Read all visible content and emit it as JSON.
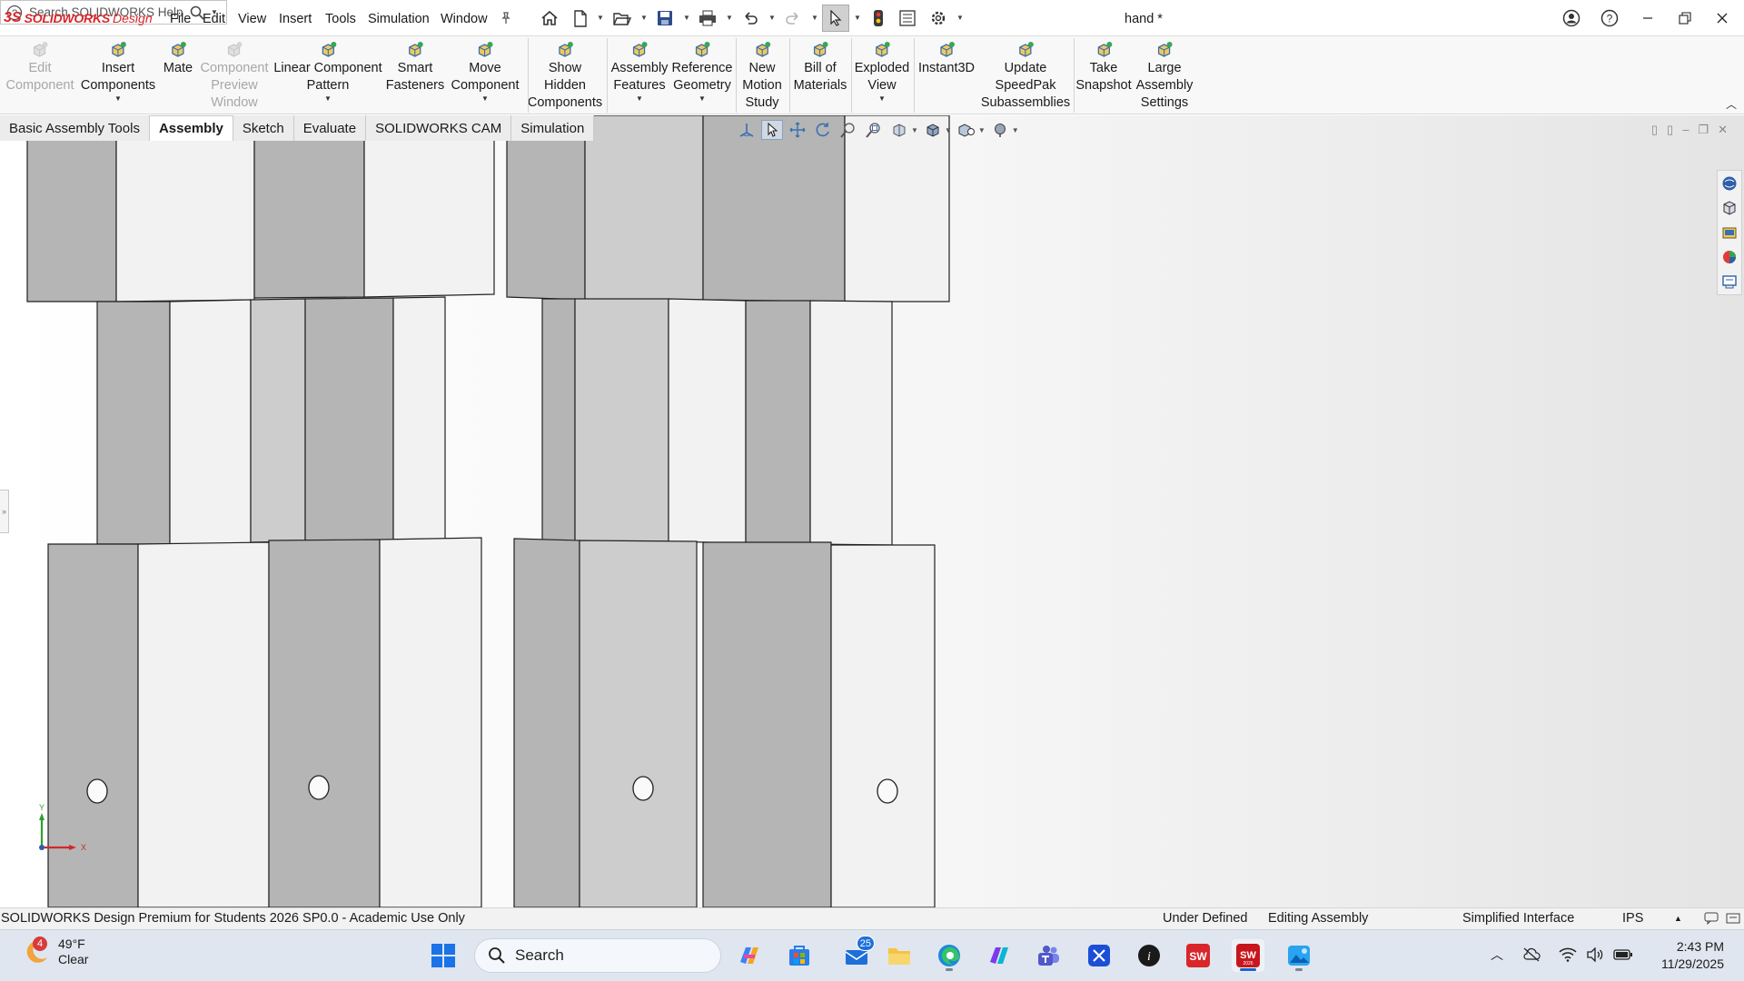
{
  "app": {
    "logo_prefix": "3S",
    "brand": "SOLIDWORKS",
    "brand_suffix": "Design",
    "document_title": "hand *"
  },
  "menu": [
    "File",
    "Edit",
    "View",
    "Insert",
    "Tools",
    "Simulation",
    "Window"
  ],
  "help_search": {
    "placeholder": "Search SOLIDWORKS Help"
  },
  "command_manager": [
    {
      "id": "edit-component",
      "lines": [
        "Edit",
        "Component"
      ],
      "disabled": true,
      "dropdown": false,
      "icon": "edit-component-icon"
    },
    {
      "id": "insert-components",
      "lines": [
        "Insert",
        "Components"
      ],
      "disabled": false,
      "dropdown": true,
      "icon": "insert-components-icon"
    },
    {
      "id": "mate",
      "lines": [
        "Mate"
      ],
      "disabled": false,
      "dropdown": false,
      "icon": "mate-icon"
    },
    {
      "id": "component-preview-window",
      "lines": [
        "Component",
        "Preview",
        "Window"
      ],
      "disabled": true,
      "dropdown": false,
      "icon": "preview-window-icon"
    },
    {
      "id": "linear-component-pattern",
      "lines": [
        "Linear Component",
        "Pattern"
      ],
      "disabled": false,
      "dropdown": true,
      "icon": "linear-pattern-icon"
    },
    {
      "id": "smart-fasteners",
      "lines": [
        "Smart",
        "Fasteners"
      ],
      "disabled": false,
      "dropdown": false,
      "icon": "smart-fasteners-icon"
    },
    {
      "id": "move-component",
      "lines": [
        "Move",
        "Component"
      ],
      "disabled": false,
      "dropdown": true,
      "icon": "move-component-icon"
    },
    {
      "id": "show-hidden-components",
      "lines": [
        "Show",
        "Hidden",
        "Components"
      ],
      "disabled": false,
      "dropdown": false,
      "icon": "show-hidden-icon"
    },
    {
      "id": "assembly-features",
      "lines": [
        "Assembly",
        "Features"
      ],
      "disabled": false,
      "dropdown": true,
      "icon": "assembly-features-icon"
    },
    {
      "id": "reference-geometry",
      "lines": [
        "Reference",
        "Geometry"
      ],
      "disabled": false,
      "dropdown": true,
      "icon": "reference-geometry-icon"
    },
    {
      "id": "new-motion-study",
      "lines": [
        "New",
        "Motion",
        "Study"
      ],
      "disabled": false,
      "dropdown": false,
      "icon": "motion-study-icon"
    },
    {
      "id": "bill-of-materials",
      "lines": [
        "Bill of",
        "Materials"
      ],
      "disabled": false,
      "dropdown": false,
      "icon": "bom-icon"
    },
    {
      "id": "exploded-view",
      "lines": [
        "Exploded",
        "View"
      ],
      "disabled": false,
      "dropdown": true,
      "icon": "exploded-view-icon"
    },
    {
      "id": "instant3d",
      "lines": [
        "Instant3D"
      ],
      "disabled": false,
      "dropdown": false,
      "icon": "instant3d-icon"
    },
    {
      "id": "update-speedpak",
      "lines": [
        "Update",
        "SpeedPak",
        "Subassemblies"
      ],
      "disabled": false,
      "dropdown": false,
      "icon": "speedpak-icon"
    },
    {
      "id": "take-snapshot",
      "lines": [
        "Take",
        "Snapshot"
      ],
      "disabled": false,
      "dropdown": false,
      "icon": "snapshot-icon"
    },
    {
      "id": "large-assembly-settings",
      "lines": [
        "Large",
        "Assembly",
        "Settings"
      ],
      "disabled": false,
      "dropdown": false,
      "icon": "large-assembly-icon"
    }
  ],
  "tabs": [
    {
      "label": "Basic Assembly Tools",
      "active": false
    },
    {
      "label": "Assembly",
      "active": true
    },
    {
      "label": "Sketch",
      "active": false
    },
    {
      "label": "Evaluate",
      "active": false
    },
    {
      "label": "SOLIDWORKS CAM",
      "active": false
    },
    {
      "label": "Simulation",
      "active": false
    }
  ],
  "triad": {
    "x_label": "X",
    "y_label": "Y"
  },
  "status_bar": {
    "product": "SOLIDWORKS Design Premium for Students 2026 SP0.0 - Academic Use Only",
    "definition": "Under Defined",
    "mode": "Editing Assembly",
    "interface": "Simplified Interface",
    "units": "IPS"
  },
  "taskbar": {
    "weather_badge": "4",
    "temperature": "49°F",
    "condition": "Clear",
    "search_label": "Search",
    "mail_badge": "25",
    "time": "2:43 PM",
    "date": "11/29/2025"
  },
  "colors": {
    "brand_red": "#d9262b",
    "face_dark": "#b5b5b5",
    "face_mid": "#cdcdcd",
    "face_light": "#f2f2f2",
    "taskbar_bg": "#dfe6ef"
  }
}
